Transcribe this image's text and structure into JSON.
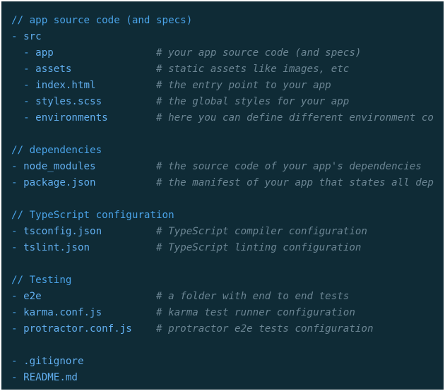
{
  "sections": [
    {
      "comment": "// app source code (and specs)",
      "items": [
        {
          "indent": 0,
          "name": "src",
          "note": ""
        },
        {
          "indent": 1,
          "name": "app",
          "note": "# your app source code (and specs)"
        },
        {
          "indent": 1,
          "name": "assets",
          "note": "# static assets like images, etc"
        },
        {
          "indent": 1,
          "name": "index.html",
          "note": "# the entry point to your app"
        },
        {
          "indent": 1,
          "name": "styles.scss",
          "note": "# the global styles for your app"
        },
        {
          "indent": 1,
          "name": "environments",
          "note": "# here you can define different environment co"
        }
      ]
    },
    {
      "comment": "// dependencies",
      "items": [
        {
          "indent": 0,
          "name": "node_modules",
          "note": "# the source code of your app's dependencies"
        },
        {
          "indent": 0,
          "name": "package.json",
          "note": "# the manifest of your app that states all dep"
        }
      ]
    },
    {
      "comment": "// TypeScript configuration",
      "items": [
        {
          "indent": 0,
          "name": "tsconfig.json",
          "note": "# TypeScript compiler configuration"
        },
        {
          "indent": 0,
          "name": "tslint.json",
          "note": "# TypeScript linting configuration"
        }
      ]
    },
    {
      "comment": "// Testing",
      "items": [
        {
          "indent": 0,
          "name": "e2e",
          "note": "# a folder with end to end tests"
        },
        {
          "indent": 0,
          "name": "karma.conf.js",
          "note": "# karma test runner configuration"
        },
        {
          "indent": 0,
          "name": "protractor.conf.js",
          "note": "# protractor e2e tests configuration"
        }
      ]
    },
    {
      "comment": "",
      "items": [
        {
          "indent": 0,
          "name": ".gitignore",
          "note": ""
        },
        {
          "indent": 0,
          "name": "README.md",
          "note": ""
        }
      ]
    }
  ],
  "colors": {
    "background": "#0f2b36",
    "comment": "#4aa3e8",
    "name": "#61aeee",
    "note": "#6b8593"
  }
}
